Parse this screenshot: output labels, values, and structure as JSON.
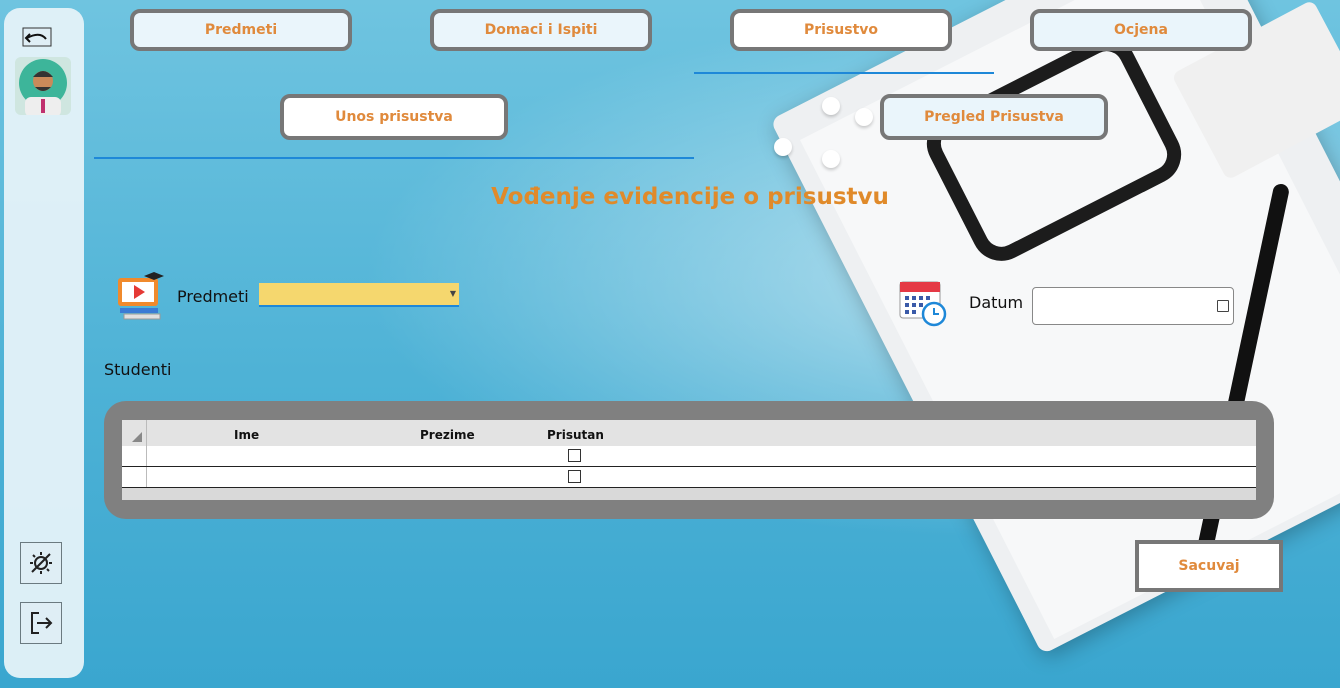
{
  "tabs": {
    "predmeti": "Predmeti",
    "domaci": "Domaci i Ispiti",
    "prisustvo": "Prisustvo",
    "ocjena": "Ocjena"
  },
  "subtabs": {
    "unos": "Unos prisustva",
    "pregled": "Pregled Prisustva"
  },
  "page_title": "Vođenje evidencije o prisustvu",
  "form": {
    "predmeti_label": "Predmeti",
    "predmeti_value": "",
    "datum_label": "Datum",
    "datum_value": "",
    "studenti_label": "Studenti"
  },
  "grid": {
    "columns": [
      "Ime",
      "Prezime",
      "Prisutan"
    ],
    "rows": [
      {
        "ime": "",
        "prezime": "",
        "prisutan": false
      },
      {
        "ime": "",
        "prezime": "",
        "prisutan": false
      }
    ]
  },
  "save_label": "Sacuvaj",
  "icons": {
    "undo": "undo-icon",
    "avatar": "user-avatar",
    "theme": "theme-toggle-icon",
    "logout": "logout-icon",
    "subject": "subject-icon",
    "calendar": "calendar-icon"
  },
  "colors": {
    "accent": "#e08a3c",
    "underline": "#1e88d8",
    "combo_bg": "#f5d76e"
  }
}
